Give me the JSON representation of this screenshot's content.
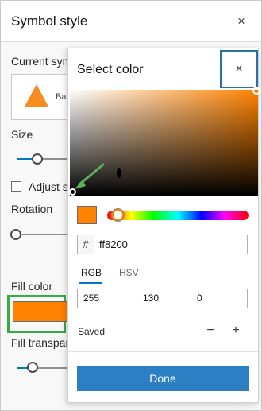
{
  "panel": {
    "title": "Symbol style",
    "close_icon": "close-icon",
    "current_symbol_label": "Current sym",
    "symbol_name": "Bas",
    "size_label": "Size",
    "adjust_label": "Adjust s",
    "rotation_label": "Rotation",
    "fill_color_label": "Fill color",
    "fill_transparency_label": "Fill transpar",
    "fill_color": "#ff8200",
    "symbol_color": "#f68b1f"
  },
  "popover": {
    "title": "Select color",
    "close_glyph": "×",
    "hex_prefix": "#",
    "hex_value": "ff8200",
    "tabs": [
      {
        "label": "RGB",
        "active": true
      },
      {
        "label": "HSV",
        "active": false
      }
    ],
    "rgb": [
      "255",
      "130",
      "0"
    ],
    "saved_label": "Saved",
    "remove_glyph": "−",
    "add_glyph": "+",
    "done_label": "Done",
    "current_color": "#ff8200",
    "accent_color": "#007ac2",
    "highlight_color": "#35ac46"
  }
}
